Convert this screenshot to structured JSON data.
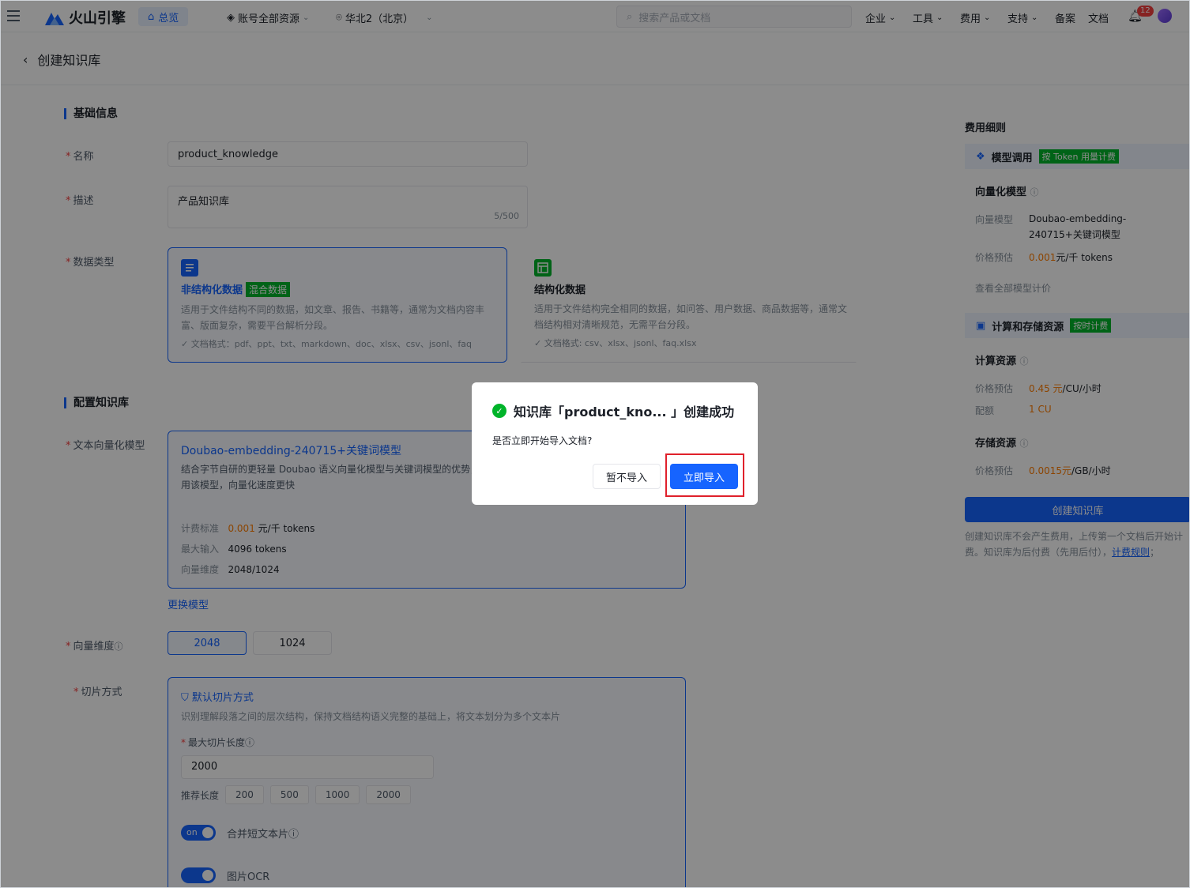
{
  "topbar": {
    "brand": "火山引擎",
    "home": "总览",
    "account": "账号全部资源",
    "region": "华北2（北京）",
    "search_placeholder": "搜索产品或文档",
    "nav": [
      "企业",
      "工具",
      "费用",
      "支持",
      "备案",
      "文档"
    ],
    "notif_count": "12"
  },
  "page": {
    "title": "创建知识库"
  },
  "basic": {
    "section": "基础信息",
    "name_label": "名称",
    "name_value": "product_knowledge",
    "desc_label": "描述",
    "desc_value": "产品知识库",
    "desc_count": "5/500",
    "type_label": "数据类型",
    "unstructured": {
      "title": "非结构化数据",
      "tag": "混合数据",
      "desc": "适用于文件结构不同的数据，如文章、报告、书籍等，通常为文档内容丰富、版面复杂，需要平台解析分段。",
      "formats": "文档格式：pdf、ppt、txt、markdown、doc、xlsx、csv、jsonl、faq"
    },
    "structured": {
      "title": "结构化数据",
      "desc": "适用于文件结构完全相同的数据，如问答、用户数据、商品数据等，通常文档结构相对清晰规范，无需平台分段。",
      "formats": "文档格式: csv、xlsx、jsonl、faq.xlsx"
    }
  },
  "config": {
    "section": "配置知识库",
    "model_label": "文本向量化模型",
    "model": {
      "name": "Doubao-embedding-240715+关键词模型",
      "desc": "结合字节自研的更轻量 Doubao 语义向量化模型与关键词模型的优势，用该模型，向量化速度更快",
      "price_k": "计费标准",
      "price_v": "0.001",
      "price_unit": "元/千 tokens",
      "max_k": "最大输入",
      "max_v": "4096 tokens",
      "dim_k": "向量维度",
      "dim_v": "2048/1024"
    },
    "change_model": "更换模型",
    "dim_label": "向量维度",
    "dims": [
      "2048",
      "1024"
    ],
    "chunk_label": "切片方式",
    "chunk": {
      "title": "默认切片方式",
      "desc": "识别理解段落之间的层次结构，保持文档结构语义完整的基础上，将文本划分为多个文本片",
      "maxlen_label": "最大切片长度",
      "maxlen_value": "2000",
      "rec_label": "推荐长度",
      "rec": [
        "200",
        "500",
        "1000",
        "2000"
      ],
      "toggle_on": "on",
      "merge_label": "合并短文本片",
      "ocr_label": "图片OCR"
    }
  },
  "side": {
    "title": "费用细则",
    "model_call": "模型调用",
    "model_call_tag": "按 Token 用量计费",
    "vector_title": "向量化模型",
    "vm_k": "向量模型",
    "vm_v": "Doubao-embedding-240715+关键词模型",
    "vp_k": "价格预估",
    "vp_v": "0.001",
    "vp_unit": "元/千 tokens",
    "view_all": "查看全部模型计价",
    "compute_storage": "计算和存储资源",
    "compute_tag": "按时计费",
    "compute_title": "计算资源",
    "cp_k": "价格预估",
    "cp_v": "0.45 元",
    "cp_unit": "/CU/小时",
    "quota_k": "配额",
    "quota_v": "1 CU",
    "storage_title": "存储资源",
    "sp_k": "价格预估",
    "sp_v": "0.0015元",
    "sp_unit": "/GB/小时",
    "create_btn": "创建知识库",
    "note": "创建知识库不会产生费用，上传第一个文档后开始计费。知识库为后付费（先用后付），",
    "note_link": "计费规则"
  },
  "modal": {
    "title": "知识库「product_kno... 」创建成功",
    "body": "是否立即开始导入文档?",
    "cancel": "暂不导入",
    "confirm": "立即导入"
  },
  "colors": {
    "primary": "#1664ff",
    "success": "#00b42a",
    "danger": "#f53f3f",
    "orange": "#ff7d00"
  }
}
